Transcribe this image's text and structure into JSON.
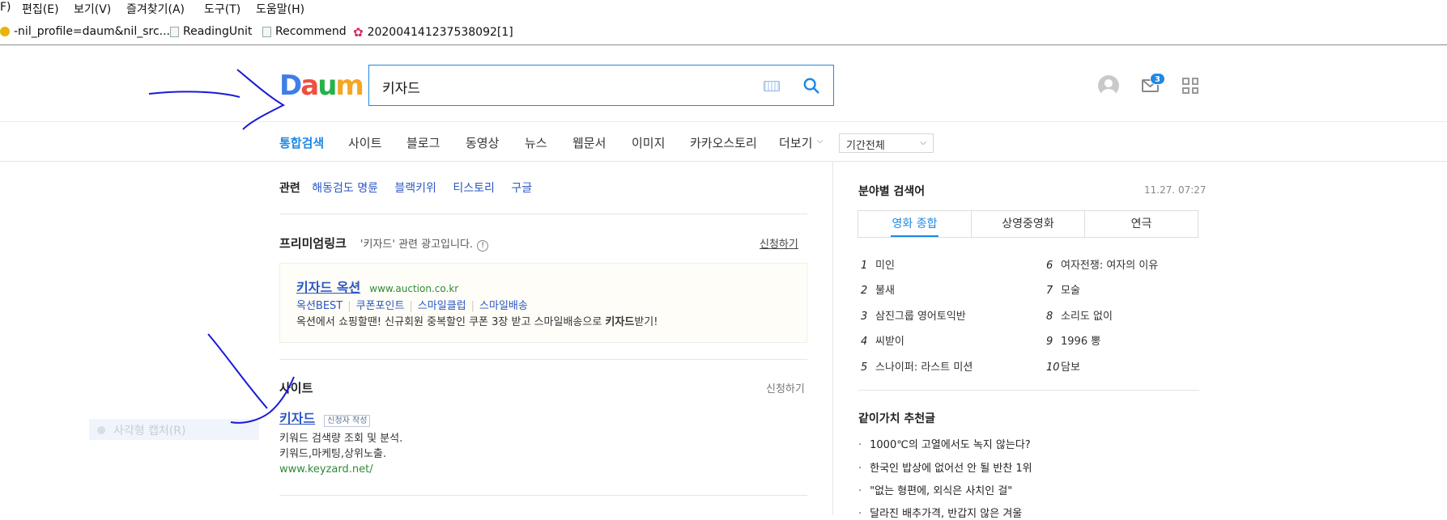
{
  "menubar": {
    "items": [
      "F)",
      "편집(E)",
      "보기(V)",
      "즐겨찾기(A)",
      "도구(T)",
      "도움말(H)"
    ]
  },
  "favorites": {
    "items": [
      "-nil_profile=daum&nil_src...",
      "ReadingUnit",
      "Recommend",
      "202004141237538092[1]"
    ]
  },
  "header": {
    "logo": "Daum",
    "search_value": "키자드",
    "mail_count": "3"
  },
  "nav": {
    "tabs": [
      "통합검색",
      "사이트",
      "블로그",
      "동영상",
      "뉴스",
      "웹문서",
      "이미지",
      "카카오스토리",
      "더보기"
    ],
    "active_tab": "통합검색",
    "period": "기간전체"
  },
  "related": {
    "label": "관련",
    "links": [
      "해동검도 명륜",
      "블랙키위",
      "티스토리",
      "구글"
    ]
  },
  "premium": {
    "title": "프리미엄링크",
    "desc": "'키자드' 관련 광고입니다.",
    "apply": "신청하기",
    "ad": {
      "title": "키자드 옥션",
      "url": "www.auction.co.kr",
      "sublinks": [
        "옥션BEST",
        "쿠폰포인트",
        "스마일클럽",
        "스마일배송"
      ],
      "desc_before": "옥션에서 쇼핑할땐! 신규회원 중복할인 쿠폰 3장 받고 스마일배송으로 ",
      "desc_bold": "키자드",
      "desc_after": "받기!"
    }
  },
  "site": {
    "title": "사이트",
    "apply": "신청하기",
    "result": {
      "title": "키자드",
      "tag": "신청자 작성",
      "line1": "키워드 검색량 조회 및 분석.",
      "line2": "키워드,마케팅,상위노출.",
      "url": "www.keyzard.net/"
    }
  },
  "sidebar": {
    "title": "분야별 검색어",
    "timestamp": "11.27. 07:27",
    "tabs": [
      "영화 종합",
      "상영중영화",
      "연극"
    ],
    "ranks": [
      {
        "n": "1",
        "t": "미인"
      },
      {
        "n": "2",
        "t": "불새"
      },
      {
        "n": "3",
        "t": "삼진그룹 영어토익반"
      },
      {
        "n": "4",
        "t": "씨받이"
      },
      {
        "n": "5",
        "t": "스나이퍼: 라스트 미션"
      },
      {
        "n": "6",
        "t": "여자전쟁: 여자의 이유"
      },
      {
        "n": "7",
        "t": "모술"
      },
      {
        "n": "8",
        "t": "소리도 없이"
      },
      {
        "n": "9",
        "t": "1996 뽕"
      },
      {
        "n": "10",
        "t": "담보"
      }
    ],
    "rec_title": "같이가치 추천글",
    "recs": [
      "1000℃의 고열에서도 녹지 않는다?",
      "한국인 밥상에 없어선 안 될 반찬 1위",
      "\"없는 형편에, 외식은 사치인 걸\"",
      "달라진 배추가격, 반갑지 않은 겨울"
    ]
  },
  "ghost_menu": "사각형 캡처(R)",
  "colors": {
    "accent": "#1e88e5",
    "link": "#2b57c4",
    "url": "#2f8a3a"
  }
}
